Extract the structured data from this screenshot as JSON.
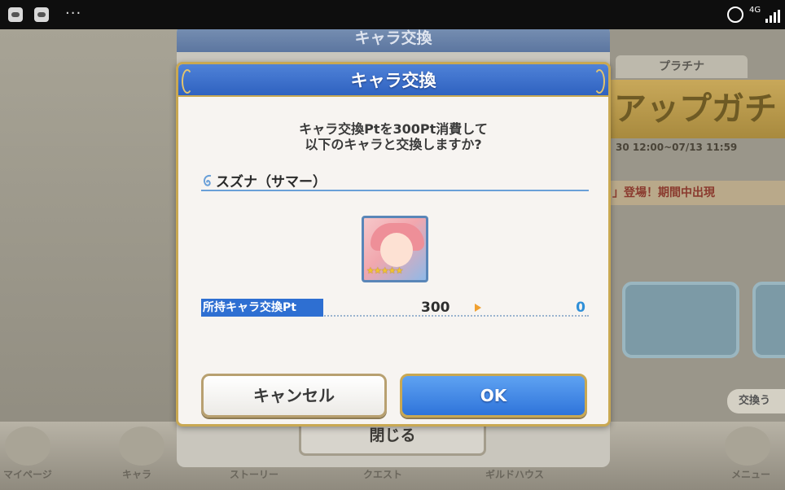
{
  "status_bar": {
    "more": "···",
    "network": "4G"
  },
  "background": {
    "tab_platinum": "プラチナ",
    "banner_text": "アップガチ",
    "date_text": "30 12:00~07/13 11:59",
    "notice_text": "」登場！期間中出現",
    "exchange_button": "交換う",
    "nav": [
      "マイページ",
      "キャラ",
      "ストーリー",
      "クエスト",
      "ギルドハウス",
      "メニュー"
    ]
  },
  "back_dialog": {
    "title": "キャラ交換",
    "close_label": "閉じる"
  },
  "dialog": {
    "title": "キャラ交換",
    "message_line1": "キャラ交換Ptを300Pt消費して",
    "message_line2": "以下のキャラと交換しますか?",
    "character_name": "スズナ（サマー）",
    "stars": "★★★★★",
    "points_label": "所持キャラ交換Pt",
    "points_current": "300",
    "points_after": "0",
    "cancel_label": "キャンセル",
    "ok_label": "OK"
  },
  "colors": {
    "header_blue": "#2f62c0",
    "accent_gold": "#c9a852",
    "ok_blue": "#2f74da",
    "points_after": "#2f8fd8"
  }
}
